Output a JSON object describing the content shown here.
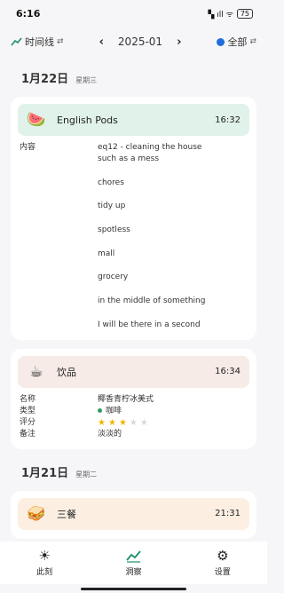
{
  "status_bar": {
    "time": "6:16",
    "signal_text": "▚ ıll ᯤ",
    "battery": "75"
  },
  "toolbar": {
    "view_icon": "trend-icon",
    "view_label": "时间线",
    "swap_glyph": "⇄",
    "month": "2025-01",
    "prev_glyph": "‹",
    "next_glyph": "›",
    "filter_label": "全部"
  },
  "days": [
    {
      "date": "1月22日",
      "weekday": "星期三",
      "cards": [
        {
          "emoji": "🍉",
          "title": "English Pods",
          "time": "16:32",
          "head_color": "#e0f2ea",
          "content_label": "内容",
          "content_lines": [
            "eq12 - cleaning the house",
            "such as a mess",
            "",
            "chores",
            "",
            "tidy up",
            "",
            "spotless",
            "",
            "mall",
            "",
            "grocery",
            "",
            "in the middle of something",
            "",
            "I will be there in a second"
          ]
        },
        {
          "emoji": "☕",
          "title": "饮品",
          "time": "16:34",
          "head_color": "#f6ebe6",
          "fields": {
            "name_label": "名称",
            "name_value": "椰香青柠冰美式",
            "type_label": "类型",
            "type_value": "咖啡",
            "rating_label": "评分",
            "rating": 3,
            "rating_max": 5,
            "note_label": "备注",
            "note_value": "淡淡的"
          }
        }
      ]
    },
    {
      "date": "1月21日",
      "weekday": "星期二",
      "cards": [
        {
          "emoji": "🥪",
          "title": "三餐",
          "time": "21:31",
          "head_color": "#fcefe2"
        }
      ]
    }
  ],
  "bottom_nav": [
    {
      "label": "此刻",
      "icon": "sun-icon",
      "glyph": "☀",
      "active": false
    },
    {
      "label": "洞察",
      "icon": "trend-icon",
      "glyph": "⩘",
      "active": true
    },
    {
      "label": "设置",
      "icon": "gear-icon",
      "glyph": "⚙",
      "active": false
    }
  ],
  "colors": {
    "accent": "#1d8f6b",
    "filter_dot": "#1e6fd9",
    "star": "#f2b400"
  }
}
